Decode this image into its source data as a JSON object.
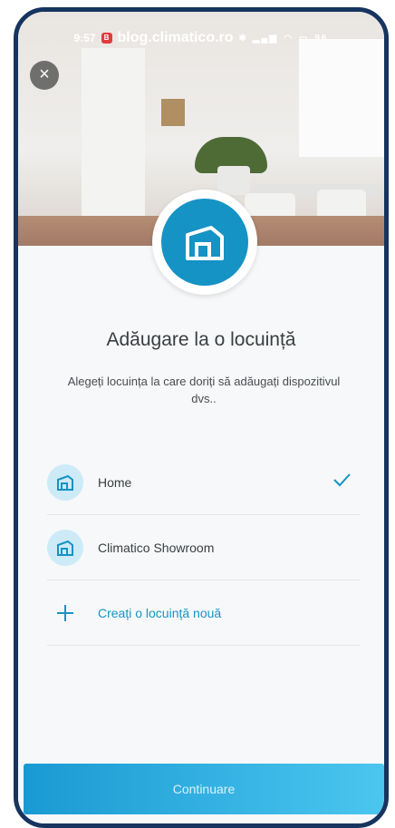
{
  "status_bar": {
    "time": "9:57",
    "record_badge": "B",
    "site": "blog.climatico.ro",
    "battery": "96"
  },
  "header": {
    "close_icon": "close-icon",
    "home_icon": "building-icon"
  },
  "main": {
    "title": "Adăugare la o locuință",
    "subtitle": "Alegeți locuința la care doriți să adăugați dispozitivul dvs.."
  },
  "homes": [
    {
      "label": "Home",
      "icon": "building-icon",
      "selected": true
    },
    {
      "label": "Climatico Showroom",
      "icon": "building-icon",
      "selected": false
    }
  ],
  "create_label": "Creați o locuință nouă",
  "continue_label": "Continuare",
  "colors": {
    "accent": "#1593c5",
    "frame": "#16345f",
    "button_start": "#1a9ad3",
    "button_end": "#4bc6ef"
  }
}
